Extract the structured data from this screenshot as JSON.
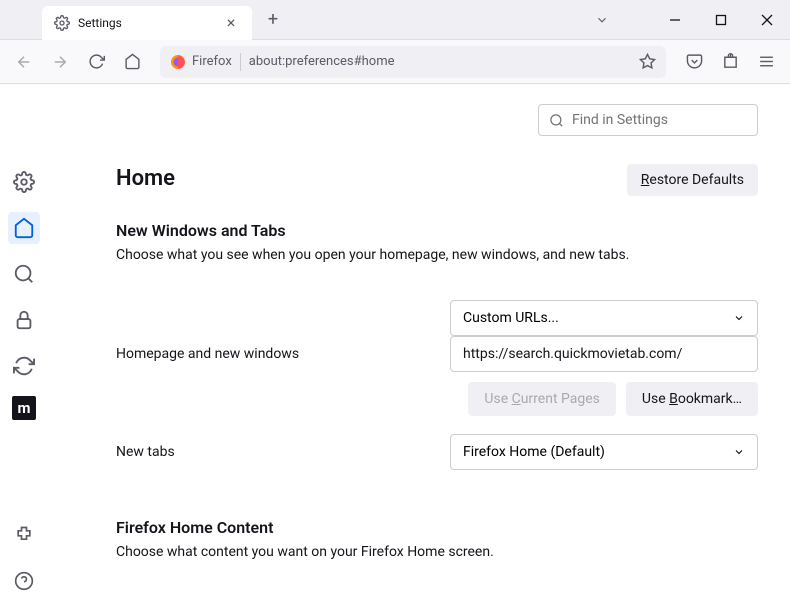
{
  "tab": {
    "title": "Settings"
  },
  "urlbar": {
    "identity": "Firefox",
    "url": "about:preferences#home"
  },
  "search": {
    "placeholder": "Find in Settings"
  },
  "page": {
    "title": "Home"
  },
  "restore": {
    "label_pre": "R",
    "label_post": "estore Defaults"
  },
  "section1": {
    "heading": "New Windows and Tabs",
    "description": "Choose what you see when you open your homepage, new windows, and new tabs."
  },
  "homepage": {
    "label": "Homepage and new windows",
    "dropdown": "Custom URLs...",
    "url_value": "https://search.quickmovietab.com/",
    "use_current_pre": "Use ",
    "use_current_u": "C",
    "use_current_post": "urrent Pages",
    "use_bookmark_pre": "Use ",
    "use_bookmark_u": "B",
    "use_bookmark_post": "ookmark…"
  },
  "newtabs": {
    "label": "New tabs",
    "dropdown": "Firefox Home (Default)"
  },
  "section2": {
    "heading": "Firefox Home Content",
    "description": "Choose what content you want on your Firefox Home screen."
  }
}
